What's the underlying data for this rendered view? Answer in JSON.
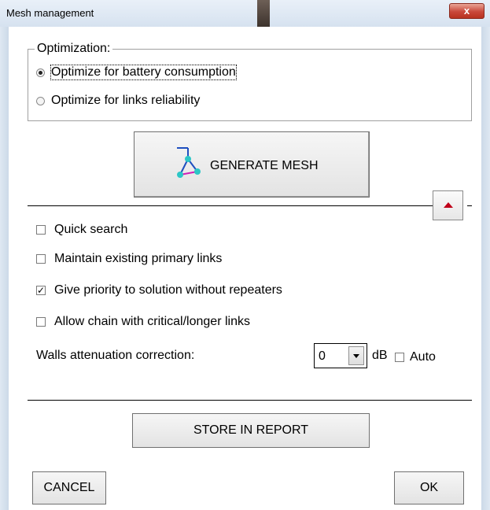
{
  "window": {
    "title": "Mesh management",
    "close_glyph": "x"
  },
  "optimization": {
    "legend": "Optimization:",
    "options": [
      {
        "label": "Optimize for battery consumption",
        "selected": true
      },
      {
        "label": "Optimize for links reliability",
        "selected": false
      }
    ]
  },
  "generate_button": {
    "label": "GENERATE MESH",
    "icon": "mesh-triangle-icon"
  },
  "collapse_button": {
    "icon": "collapse-up-icon",
    "color": "#c0001a"
  },
  "options": [
    {
      "label": "Quick search",
      "checked": false
    },
    {
      "label": "Maintain existing primary links",
      "checked": false
    },
    {
      "label": "Give priority to solution without repeaters",
      "checked": true
    },
    {
      "label": "Allow chain with critical/longer links",
      "checked": false
    }
  ],
  "walls": {
    "label": "Walls attenuation correction:",
    "value": "0",
    "unit": "dB",
    "auto_label": "Auto",
    "auto_checked": false
  },
  "buttons": {
    "store": "STORE IN REPORT",
    "cancel": "CANCEL",
    "ok": "OK"
  }
}
